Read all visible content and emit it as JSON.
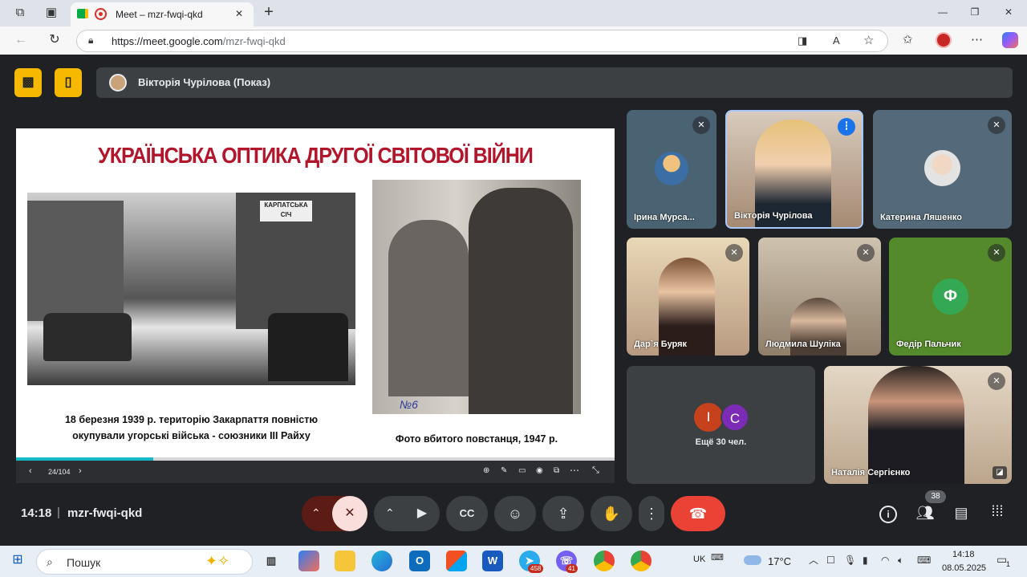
{
  "browser": {
    "tab_title": "Meet – mzr-fwqi-qkd",
    "new_tab": "+",
    "url_host": "https://meet.google.com",
    "url_path": "/mzr-fwqi-qkd",
    "read_aloud": "A",
    "window_minimize": "—",
    "window_maximize": "❐",
    "window_close": "✕"
  },
  "meet": {
    "presenter_label": "Вікторія Чурілова (Показ)",
    "time": "14:18",
    "separator": "|",
    "meeting_code": "mzr-fwqi-qkd",
    "participants_count": "38",
    "more_count_label": "Ещё 30 чел.",
    "more_avatars": [
      {
        "letter": "I",
        "color": "#c5421c"
      },
      {
        "letter": "C",
        "color": "#7b2bb5"
      }
    ]
  },
  "slide": {
    "title": "УКРАЇНСЬКА ОПТИКА ДРУГОЇ СВІТОВОЇ ВІЙНИ",
    "sign_text_1": "КАРПАТСЬКА",
    "sign_text_2": "СІЧ",
    "caption_left_1": "18 березня 1939 р. територію Закарпаття повністю",
    "caption_left_2": "окупували угорські війська - союзники ІІІ Райху",
    "caption_right": "Фото вбитого повстанця, 1947 р.",
    "photo_mark": "№6",
    "page_indicator": "24/104",
    "progress_fraction": 0.229
  },
  "participants": [
    {
      "name": "Ірина Мурса...",
      "muted": true,
      "avatar_color": "#5f7c8a"
    },
    {
      "name": "Вікторія Чурілова",
      "muted": false,
      "speaking": true
    },
    {
      "name": "Катерина Ляшенко",
      "muted": true
    },
    {
      "name": "Дар`я Буряк",
      "muted": true
    },
    {
      "name": "Людмила Шуліка",
      "muted": true
    },
    {
      "name": "Федір Пальчик",
      "muted": true,
      "initial": "Ф",
      "initial_color": "#34a853"
    },
    {
      "name": "Наталія Сергієнко",
      "muted": true
    }
  ],
  "taskbar": {
    "search_placeholder": "Пошук",
    "lang": "UK",
    "weather": "17°C",
    "clock_time": "14:18",
    "clock_date": "08.05.2025",
    "notif_count": "1",
    "telegram_badge": "458",
    "viber_badge": "41"
  },
  "colors": {
    "accent_yellow": "#f6b900",
    "end_call": "#ea4335",
    "mic_off_bg": "#f9dedc",
    "speaking_border": "#a8c7fa"
  }
}
